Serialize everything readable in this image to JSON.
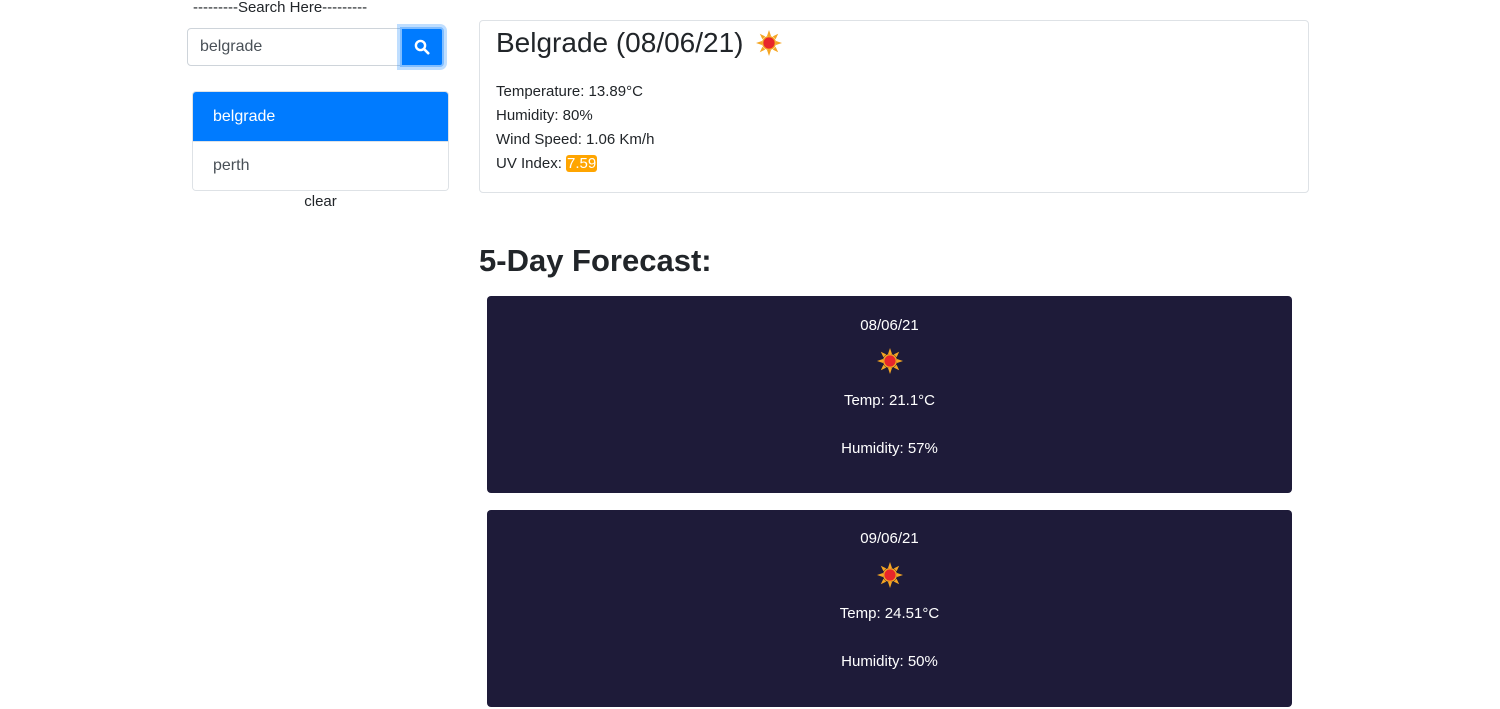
{
  "search": {
    "heading": "---------Search Here---------",
    "value": "belgrade",
    "button_icon": "search-icon"
  },
  "history": {
    "items": [
      {
        "label": "belgrade",
        "active": true
      },
      {
        "label": "perth",
        "active": false
      }
    ],
    "clear_label": "clear"
  },
  "current": {
    "title": "Belgrade (08/06/21)",
    "icon": "sun-icon",
    "temperature": "Temperature: 13.89°C",
    "humidity": "Humidity: 80%",
    "wind": "Wind Speed: 1.06 Km/h",
    "uv_label": "UV Index: ",
    "uv_value": "7.59",
    "uv_color": "#ffa500"
  },
  "forecast": {
    "title": "5-Day Forecast:",
    "card_color": "#1e1b39",
    "days": [
      {
        "date": "08/06/21",
        "icon": "sun-icon",
        "temp": "Temp: 21.1°C",
        "humidity": "Humidity: 57%"
      },
      {
        "date": "09/06/21",
        "icon": "sun-icon",
        "temp": "Temp: 24.51°C",
        "humidity": "Humidity: 50%"
      }
    ]
  },
  "colors": {
    "accent": "#007bff",
    "sun_fill": "#e8262a",
    "sun_rays": "#f5a623"
  }
}
